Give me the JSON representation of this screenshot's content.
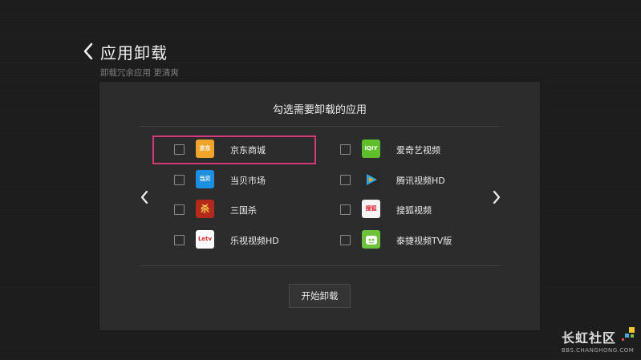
{
  "header": {
    "title": "应用卸载",
    "subtitle": "卸载冗余应用 更清爽"
  },
  "panel": {
    "title": "勾选需要卸载的应用",
    "start_label": "开始卸载"
  },
  "apps": [
    {
      "name": "京东商城",
      "icon": "jd-icon",
      "icon_text": "京东",
      "icon_color": "#f0a52a",
      "checked": false,
      "focused": true
    },
    {
      "name": "爱奇艺视频",
      "icon": "iqiyi-icon",
      "icon_text": "iQIY",
      "icon_color": "#5fbf2a",
      "checked": false,
      "focused": false
    },
    {
      "name": "当贝市场",
      "icon": "dangbei-icon",
      "icon_text": "当贝",
      "icon_color": "#1d8fe0",
      "checked": false,
      "focused": false
    },
    {
      "name": "腾讯视频HD",
      "icon": "tencent-video-icon",
      "icon_text": "",
      "icon_color": "#2ba7e8",
      "checked": false,
      "focused": false
    },
    {
      "name": "三国杀",
      "icon": "sanguosha-icon",
      "icon_text": "杀",
      "icon_color": "#b5281c",
      "checked": false,
      "focused": false
    },
    {
      "name": "搜狐视频",
      "icon": "sohu-video-icon",
      "icon_text": "搜狐",
      "icon_color": "#f4f4f4",
      "checked": false,
      "focused": false
    },
    {
      "name": "乐视视频HD",
      "icon": "letv-icon",
      "icon_text": "Letv",
      "icon_color": "#ffffff",
      "checked": false,
      "focused": false
    },
    {
      "name": "泰捷视频TV版",
      "icon": "taijie-video-icon",
      "icon_text": "",
      "icon_color": "#6cc23a",
      "checked": false,
      "focused": false
    }
  ],
  "watermark": {
    "brand": "长虹社区",
    "url": "BBS.CHANGHONG.COM"
  }
}
